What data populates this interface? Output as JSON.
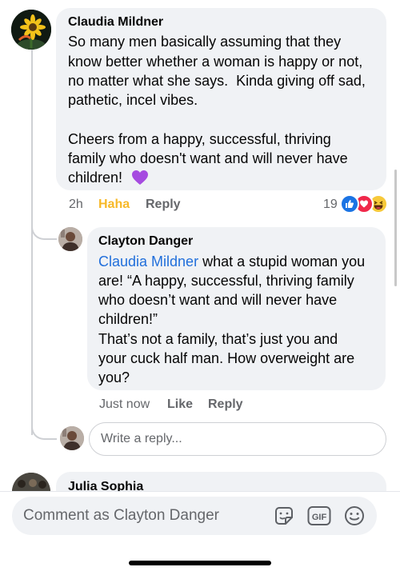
{
  "comments": [
    {
      "author": "Claudia Mildner",
      "text_line1": "So many men basically assuming that they",
      "text_line2": "know better whether a woman is happy or not,",
      "text_line3": "no matter what she says.  Kinda giving off sad,",
      "text_line4": "pathetic, incel vibes.",
      "text_line5": "Cheers from a happy, successful, thriving",
      "text_line6": "family who doesn't want and will never have",
      "text_line7": "children!",
      "time": "2h",
      "reaction_label": "Haha",
      "reply_label": "Reply",
      "reaction_count": "19"
    }
  ],
  "reply": {
    "author": "Clayton Danger",
    "mention": "Claudia Mildner",
    "text_line1_rest": " what a stupid woman you",
    "text_line2": "are! “A happy, successful, thriving family",
    "text_line3": "who doesn’t want and will never have",
    "text_line4": "children!”",
    "text_line5": "That’s not a family, that’s just you and",
    "text_line6": "your cuck half man. How overweight are",
    "text_line7": "you?",
    "time": "Just now",
    "like_label": "Like",
    "reply_label": "Reply"
  },
  "reply_input": {
    "placeholder": "Write a reply..."
  },
  "next_comment": {
    "author": "Julia Sophia"
  },
  "composer": {
    "placeholder": "Comment as Clayton Danger"
  },
  "colors": {
    "link_blue": "#216fdb",
    "haha_yellow": "#f7b928",
    "bubble_gray": "#f0f2f5",
    "meta_gray": "#65676b"
  }
}
